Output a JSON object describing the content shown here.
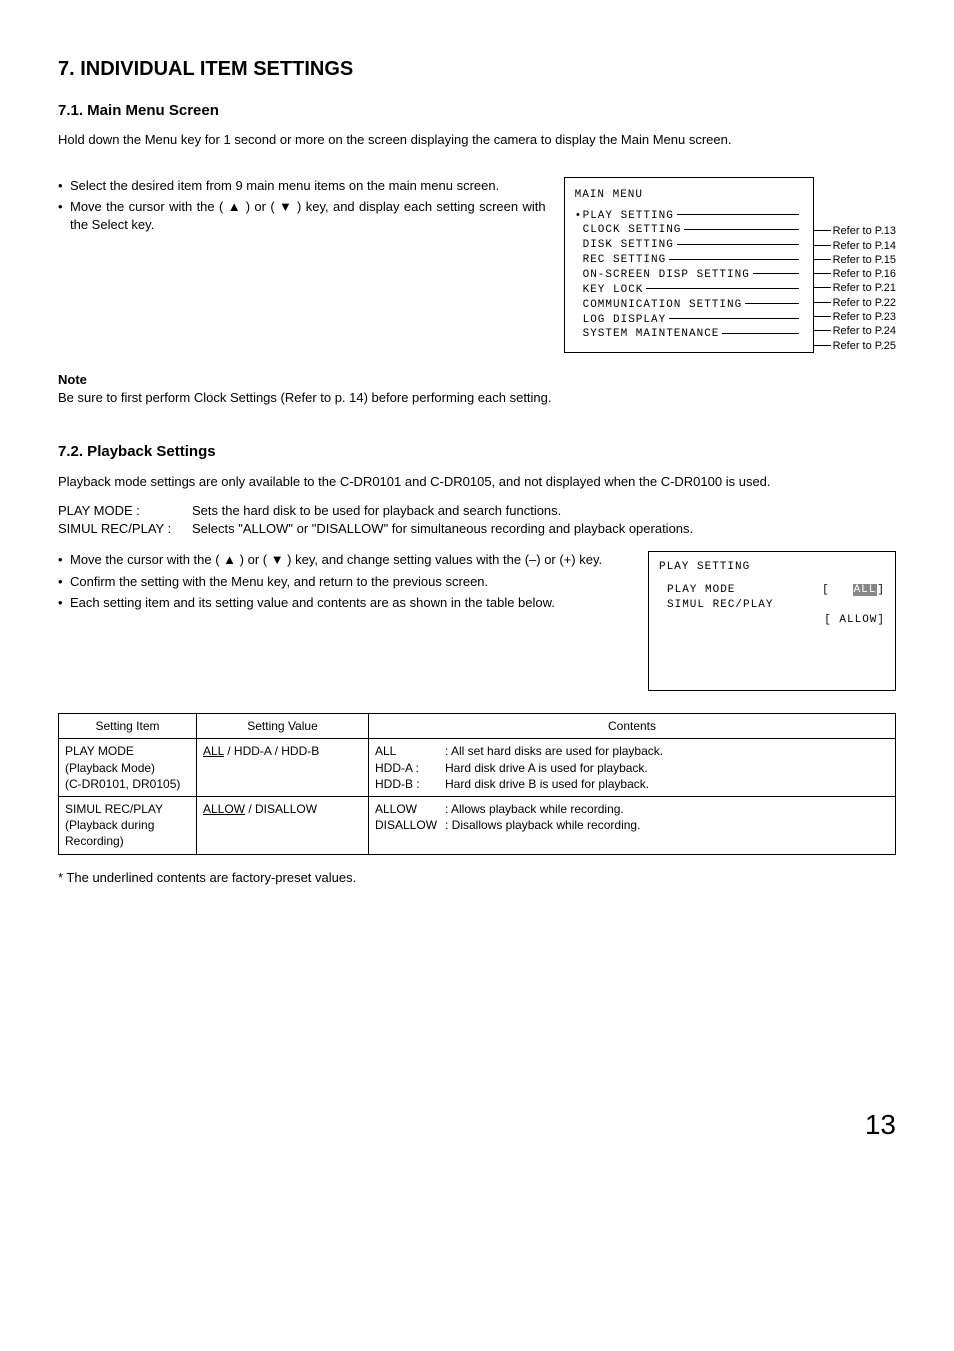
{
  "section_title": "7. INDIVIDUAL ITEM SETTINGS",
  "s71": {
    "heading": "7.1. Main Menu Screen",
    "intro": "Hold down the Menu key for 1 second or more on the screen displaying the camera to display the Main Menu screen.",
    "bullets": [
      "Select the desired item from 9 main menu items on the main menu screen.",
      "Move the cursor with the ( ▲ ) or ( ▼ ) key, and display each setting screen with the Select key."
    ],
    "menu": {
      "title": "MAIN MENU",
      "items": [
        {
          "label": "PLAY SETTING",
          "cursor": true,
          "ref": "Refer to P.13"
        },
        {
          "label": "CLOCK SETTING",
          "cursor": false,
          "ref": "Refer to P.14"
        },
        {
          "label": "DISK SETTING",
          "cursor": false,
          "ref": "Refer to P.15"
        },
        {
          "label": "REC SETTING",
          "cursor": false,
          "ref": "Refer to P.16"
        },
        {
          "label": "ON-SCREEN DISP SETTING",
          "cursor": false,
          "ref": "Refer to P.21"
        },
        {
          "label": "KEY LOCK",
          "cursor": false,
          "ref": "Refer to P.22"
        },
        {
          "label": "COMMUNICATION SETTING",
          "cursor": false,
          "ref": "Refer to P.23"
        },
        {
          "label": "LOG DISPLAY",
          "cursor": false,
          "ref": "Refer to P.24"
        },
        {
          "label": "SYSTEM MAINTENANCE",
          "cursor": false,
          "ref": "Refer to P.25"
        }
      ]
    },
    "note_head": "Note",
    "note_body": "Be sure to first perform Clock Settings (Refer to p. 14) before performing each setting."
  },
  "s72": {
    "heading": "7.2. Playback Settings",
    "intro": "Playback mode settings are only available to the C-DR0101 and C-DR0105, and not displayed when the C-DR0100 is used.",
    "defs": [
      {
        "k": "PLAY MODE :",
        "v": "Sets the hard disk to be used for playback and search functions."
      },
      {
        "k": "SIMUL REC/PLAY :",
        "v": "Selects \"ALLOW\" or \"DISALLOW\" for simultaneous recording and playback operations."
      }
    ],
    "bullets": [
      "Move the cursor with the ( ▲ ) or ( ▼ ) key, and change setting values with the (–) or (+) key.",
      "Confirm the setting with the Menu key, and return to the previous screen.",
      "Each setting item and its setting value and contents are as shown in the table below."
    ],
    "playbox": {
      "title": "PLAY SETTING",
      "rows": [
        {
          "l": "PLAY MODE",
          "r": "[   ALL]",
          "hl": "ALL"
        },
        {
          "l": "SIMUL REC/PLAY",
          "r": ""
        },
        {
          "l": "",
          "r": "[  ALLOW]"
        }
      ]
    },
    "table": {
      "headers": [
        "Setting Item",
        "Setting Value",
        "Contents"
      ],
      "rows": [
        {
          "item_lines": [
            "PLAY MODE",
            "(Playback Mode)",
            "(C-DR0101, DR0105)"
          ],
          "value_underlined": "ALL",
          "value_rest": " / HDD-A / HDD-B",
          "contents": [
            {
              "k": "ALL",
              "v": ": All set hard disks are used for playback."
            },
            {
              "k": "HDD-A :",
              "v": "Hard disk drive A is used for playback."
            },
            {
              "k": "HDD-B :",
              "v": "Hard disk drive B is used for playback."
            }
          ]
        },
        {
          "item_lines": [
            "SIMUL REC/PLAY",
            "(Playback during",
            "Recording)"
          ],
          "value_underlined": "ALLOW",
          "value_rest": " / DISALLOW",
          "contents": [
            {
              "k": "ALLOW",
              "v": ": Allows playback while recording."
            },
            {
              "k": "DISALLOW",
              "v": ": Disallows playback while recording."
            }
          ]
        }
      ]
    },
    "footnote": "* The underlined contents are factory-preset values."
  },
  "page_number": "13"
}
